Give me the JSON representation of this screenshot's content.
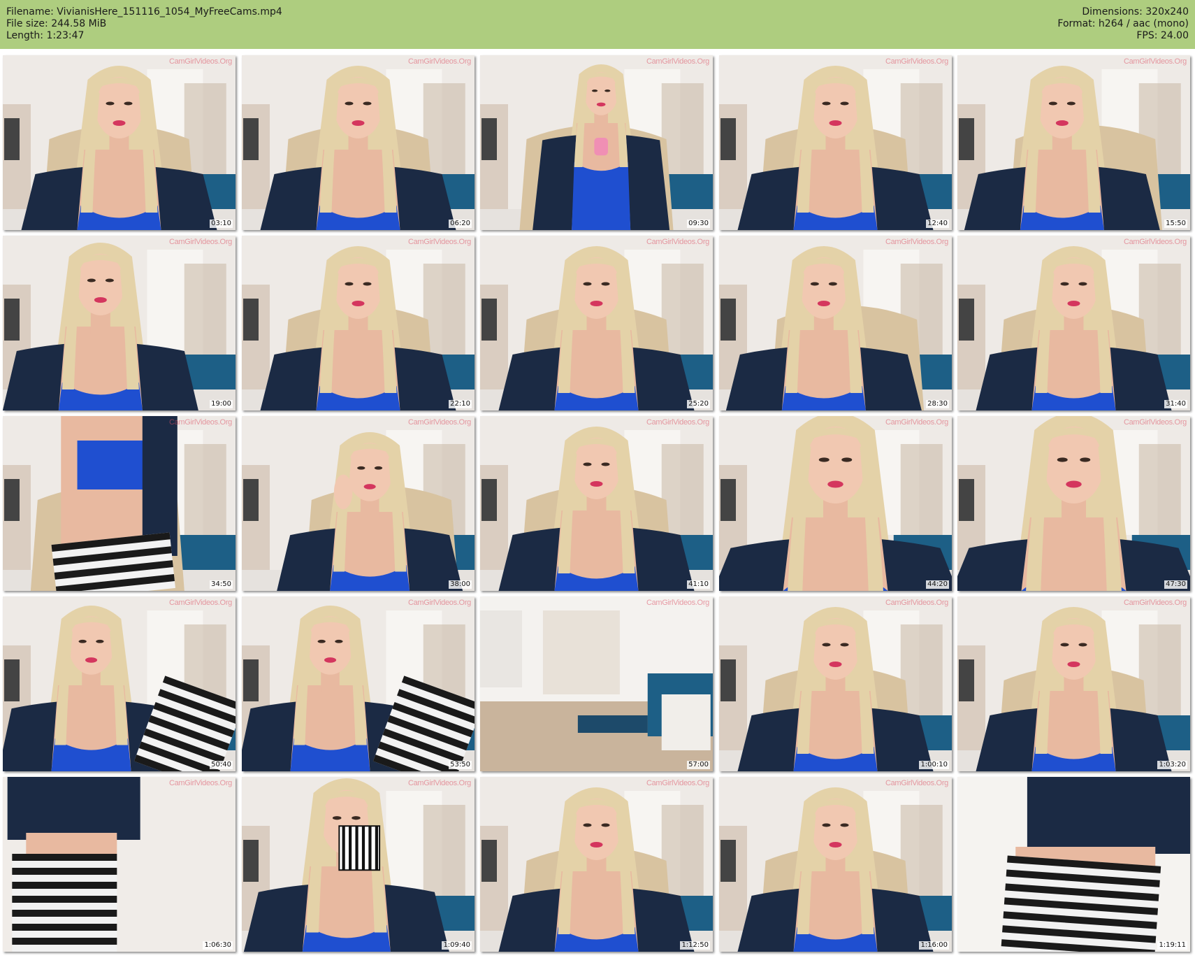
{
  "header": {
    "filename_line": "Filename: VivianisHere_151116_1054_MyFreeCams.mp4",
    "filesize_line": "File size: 244.58 MiB",
    "length_line": "Length: 1:23:47",
    "dimensions_line": "Dimensions: 320x240",
    "format_line": "Format: h264 / aac (mono)",
    "fps_line": "FPS: 24.00"
  },
  "watermark": "CamGirlVideos.Org",
  "colors": {
    "header_bg": "#aecd7f",
    "cardigan": "#1b2a44",
    "top": "#1f4fd0",
    "hair": "#e4d2a8",
    "skin": "#e8b9a0",
    "wall": "#eeeae6",
    "chair": "#d8c3a0",
    "sofa": "#1d5f86"
  },
  "thumbnails": [
    {
      "time": "03:10",
      "scene": "face-forward"
    },
    {
      "time": "06:20",
      "scene": "face-forward"
    },
    {
      "time": "09:30",
      "scene": "chair-phone"
    },
    {
      "time": "12:40",
      "scene": "face-forward"
    },
    {
      "time": "15:50",
      "scene": "face-turned"
    },
    {
      "time": "19:00",
      "scene": "face-left"
    },
    {
      "time": "22:10",
      "scene": "face-forward"
    },
    {
      "time": "25:20",
      "scene": "face-forward"
    },
    {
      "time": "28:30",
      "scene": "face-turned"
    },
    {
      "time": "31:40",
      "scene": "face-forward"
    },
    {
      "time": "34:50",
      "scene": "torso-standing"
    },
    {
      "time": "38:00",
      "scene": "face-hand"
    },
    {
      "time": "41:10",
      "scene": "face-forward"
    },
    {
      "time": "44:20",
      "scene": "face-close"
    },
    {
      "time": "47:30",
      "scene": "face-close"
    },
    {
      "time": "50:40",
      "scene": "seated-knees"
    },
    {
      "time": "53:50",
      "scene": "seated-knees"
    },
    {
      "time": "57:00",
      "scene": "empty-room"
    },
    {
      "time": "1:00:10",
      "scene": "face-forward"
    },
    {
      "time": "1:03:20",
      "scene": "face-forward"
    },
    {
      "time": "1:06:30",
      "scene": "back-standing"
    },
    {
      "time": "1:09:40",
      "scene": "face-mug"
    },
    {
      "time": "1:12:50",
      "scene": "face-forward"
    },
    {
      "time": "1:16:00",
      "scene": "face-forward"
    },
    {
      "time": "1:19:11",
      "scene": "back-close"
    }
  ]
}
